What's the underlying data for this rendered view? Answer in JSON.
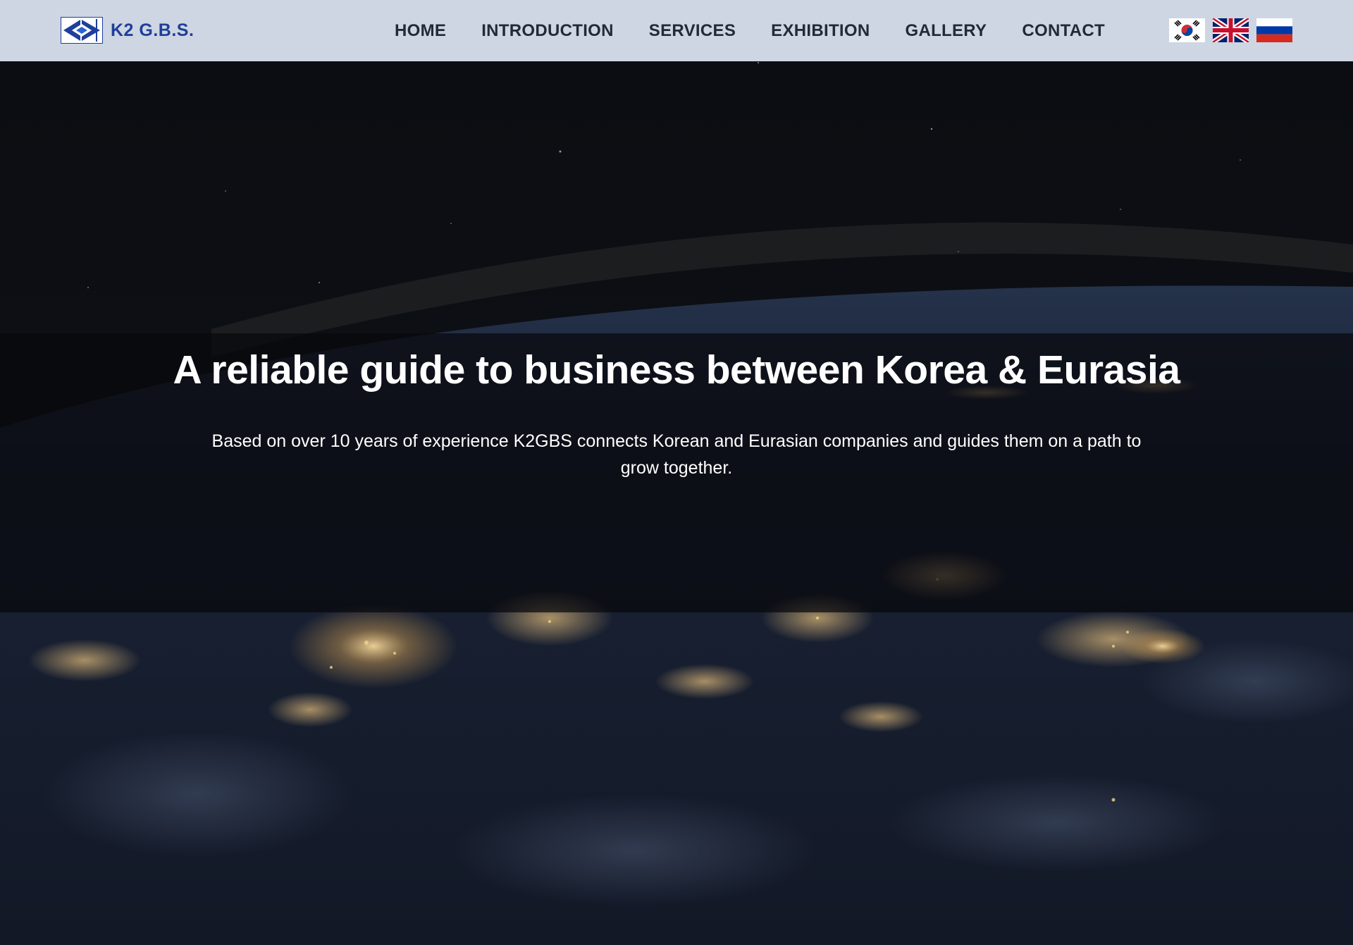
{
  "header": {
    "logo_text": "K2 G.B.S.",
    "nav": [
      {
        "label": "HOME"
      },
      {
        "label": "INTRODUCTION"
      },
      {
        "label": "SERVICES"
      },
      {
        "label": "EXHIBITION"
      },
      {
        "label": "GALLERY"
      },
      {
        "label": "CONTACT"
      }
    ],
    "flags": [
      "korean-flag-icon",
      "uk-flag-icon",
      "russian-flag-icon"
    ]
  },
  "hero": {
    "title": "A reliable guide to business between Korea & Eurasia",
    "subtitle": "Based on over 10 years of experience K2GBS connects Korean and Eurasian companies and guides them on a path to grow together."
  },
  "colors": {
    "header_bg": "#cdd6e2",
    "logo_blue": "#1f3f9a",
    "nav_text": "#222a36",
    "hero_text": "#ffffff"
  }
}
